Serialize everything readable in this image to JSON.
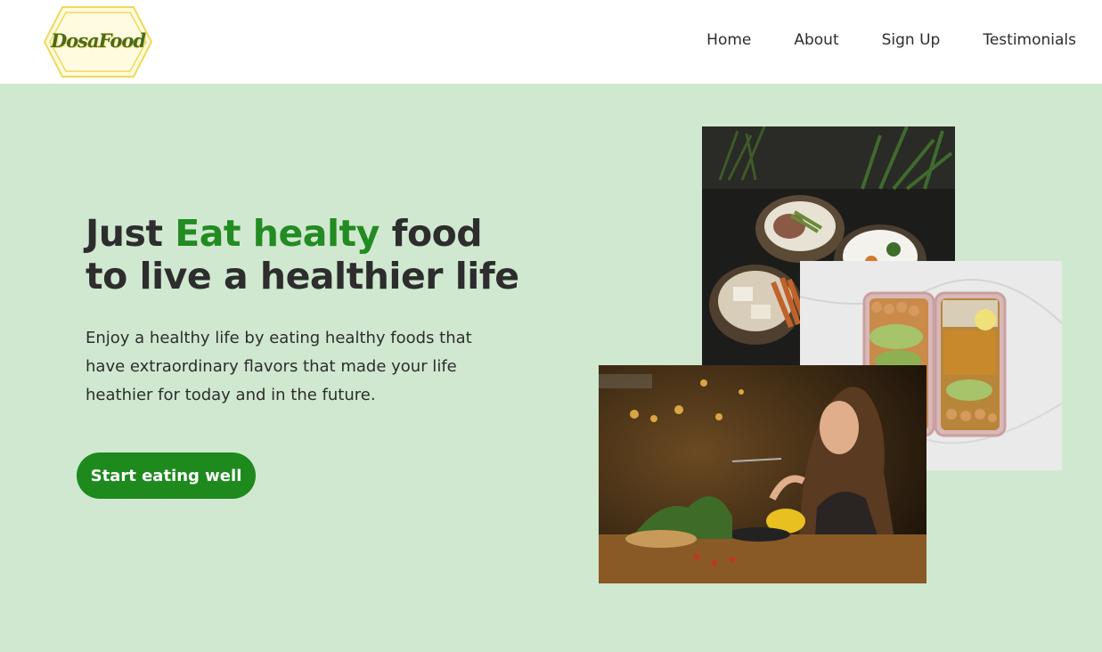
{
  "header": {
    "logo_text": "DosaFood",
    "nav": [
      "Home",
      "About",
      "Sign Up",
      "Testimonials"
    ]
  },
  "hero": {
    "headline_pre": "Just ",
    "headline_highlight": "Eat healty",
    "headline_mid": " food",
    "headline_line2": "to live a healthier life",
    "description": "Enjoy a healthy life by eating healthy foods that have extraordinary flavors that made your life heathier for today and in the future.",
    "cta_label": "Start eating well"
  },
  "colors": {
    "hero_background": "#d0e8d0",
    "accent_green": "#228b22",
    "button_green": "#1e8a1e",
    "logo_gold": "#f3e27a"
  },
  "images": [
    {
      "name": "food-bowls-photo"
    },
    {
      "name": "meal-prep-photo"
    },
    {
      "name": "woman-eating-photo"
    }
  ]
}
